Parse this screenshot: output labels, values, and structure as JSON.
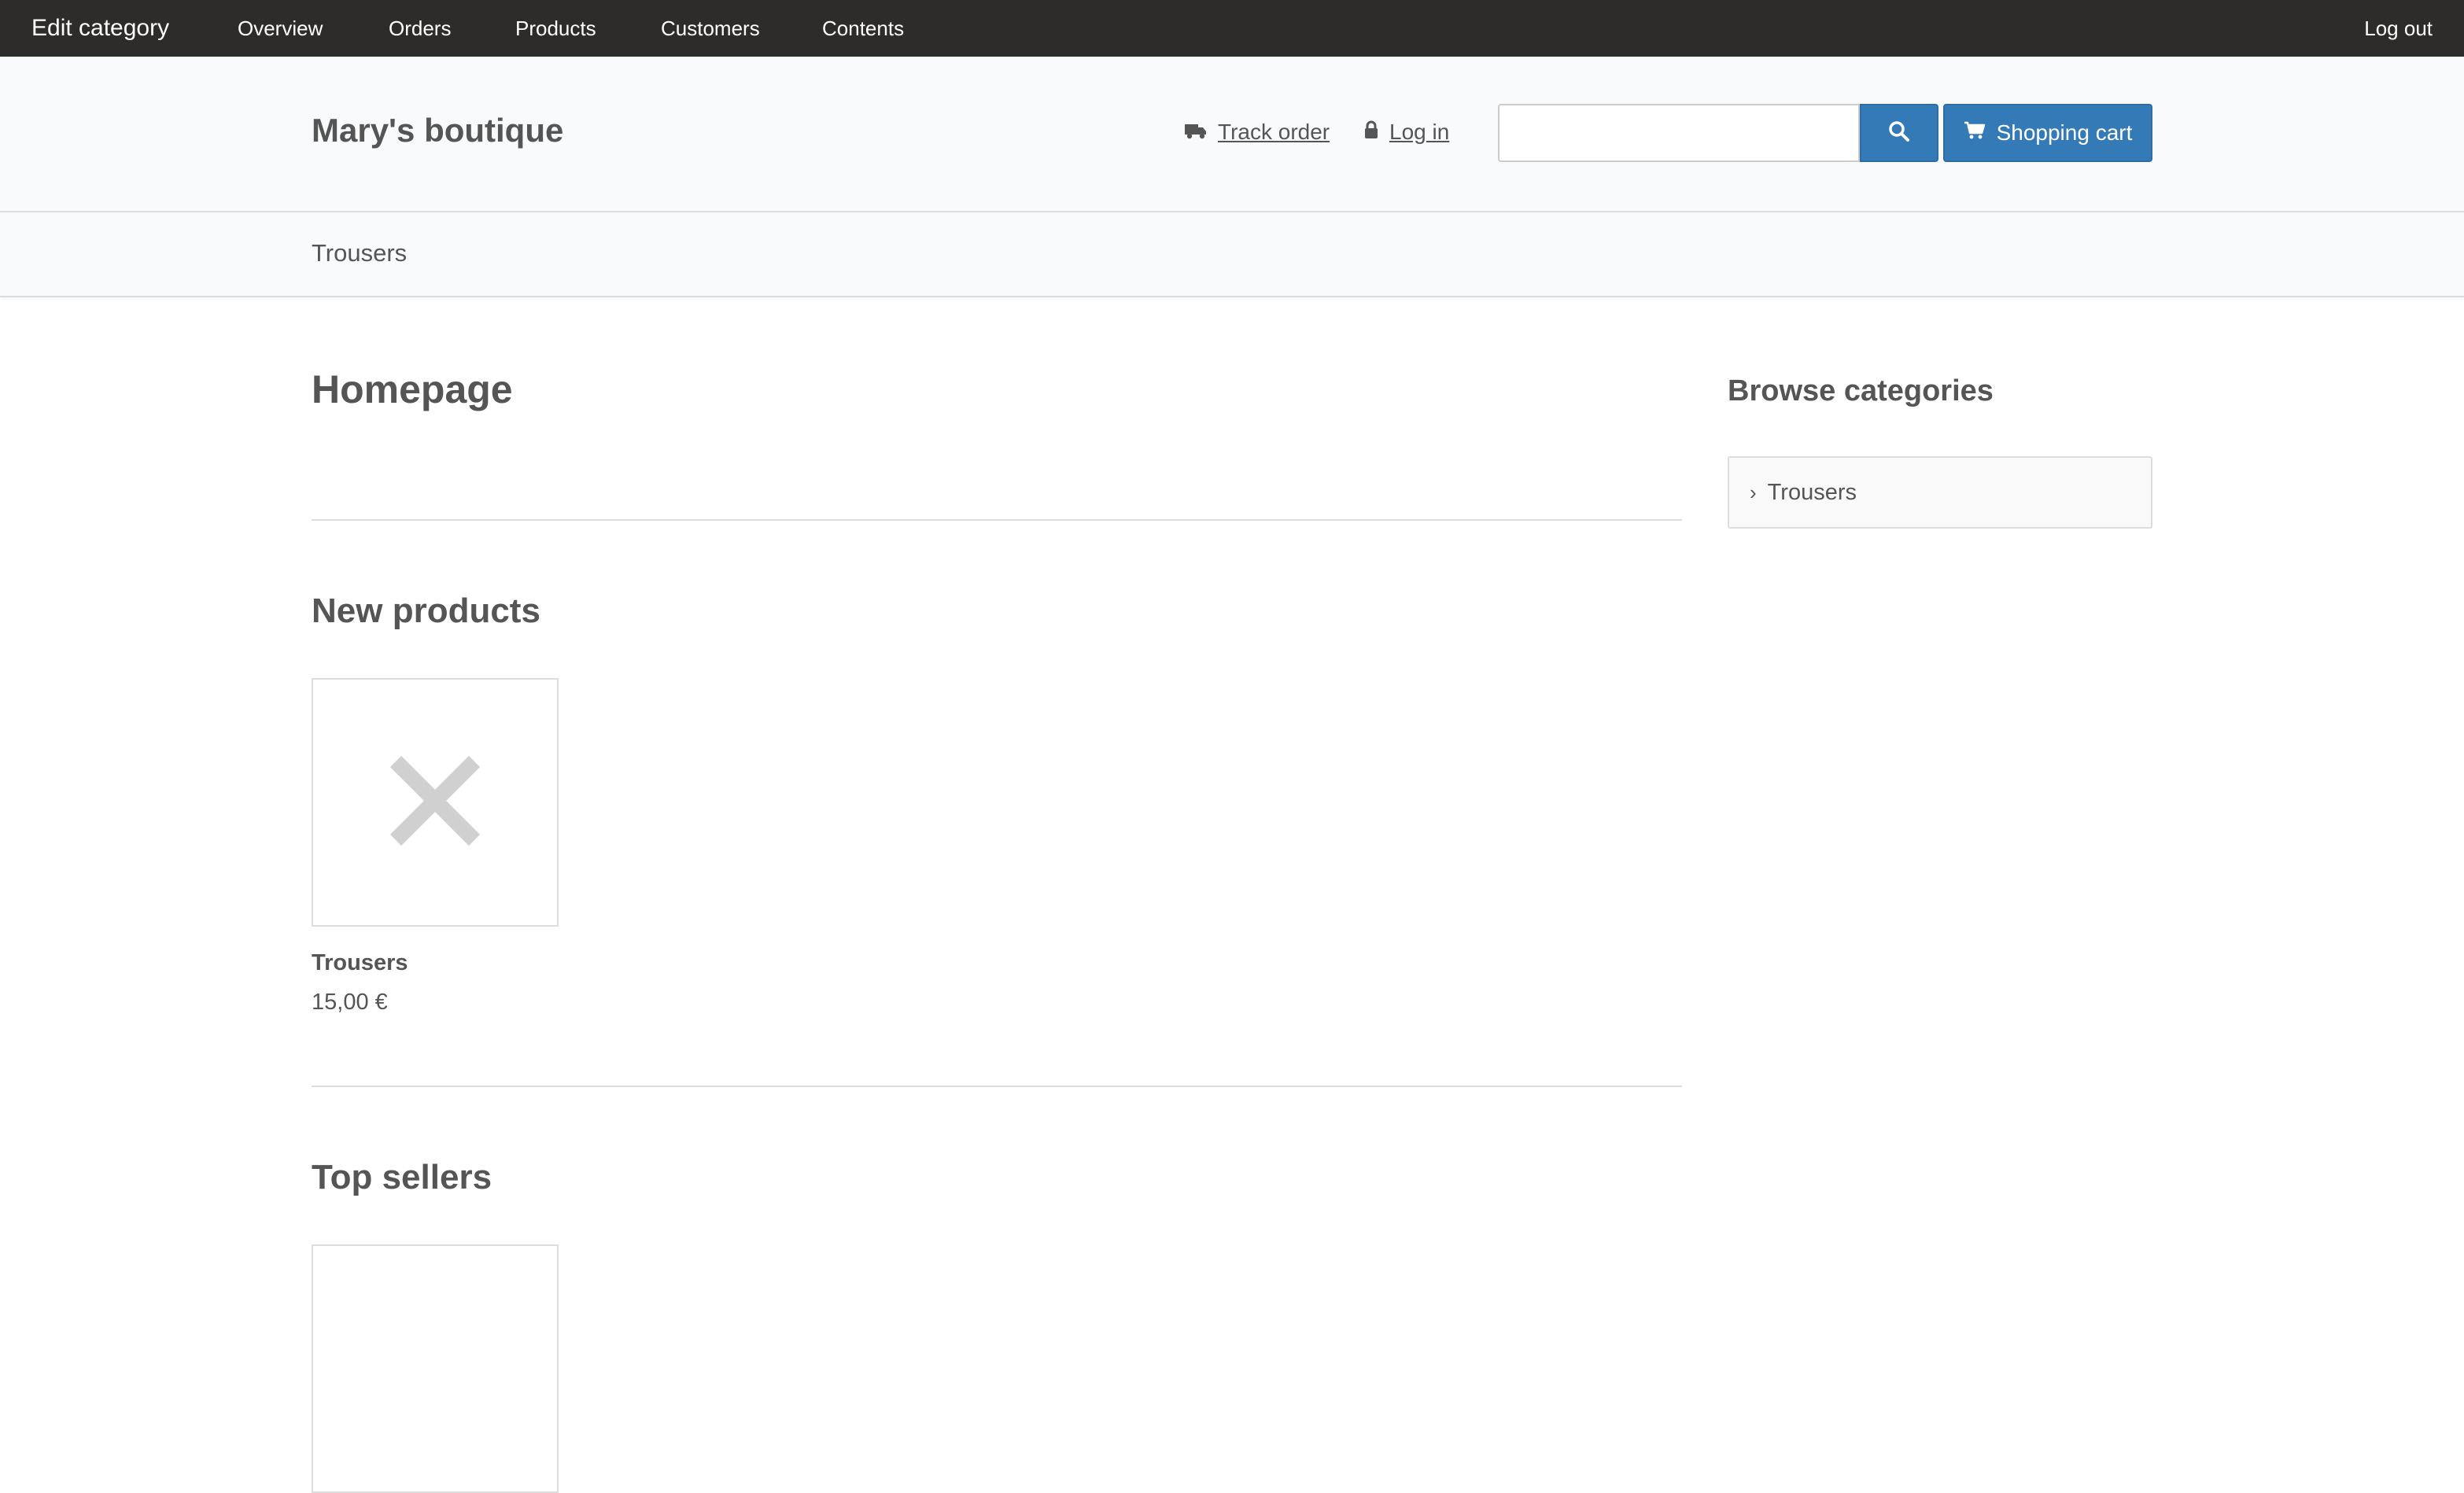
{
  "adminbar": {
    "title": "Edit category",
    "nav": [
      "Overview",
      "Orders",
      "Products",
      "Customers",
      "Contents"
    ],
    "logout": "Log out"
  },
  "header": {
    "shop_name": "Mary's boutique",
    "track_order": "Track order",
    "login": "Log in",
    "search": {
      "value": "",
      "placeholder": ""
    },
    "cart_label": "Shopping cart"
  },
  "catbar": {
    "items": [
      "Trousers"
    ]
  },
  "main": {
    "title": "Homepage",
    "new_products": {
      "heading": "New products",
      "items": [
        {
          "name": "Trousers",
          "price": "15,00 €"
        }
      ]
    },
    "top_sellers": {
      "heading": "Top sellers"
    }
  },
  "sidebar": {
    "title": "Browse categories",
    "items": [
      "Trousers"
    ]
  },
  "colors": {
    "adminbar_bg": "#2d2c2a",
    "primary_button": "#337ab7",
    "header_bg": "#f8fafc",
    "text": "#555555"
  },
  "icons": [
    "truck-icon",
    "lock-icon",
    "search-icon",
    "cart-icon",
    "chevron-right-icon",
    "image-placeholder-icon"
  ]
}
